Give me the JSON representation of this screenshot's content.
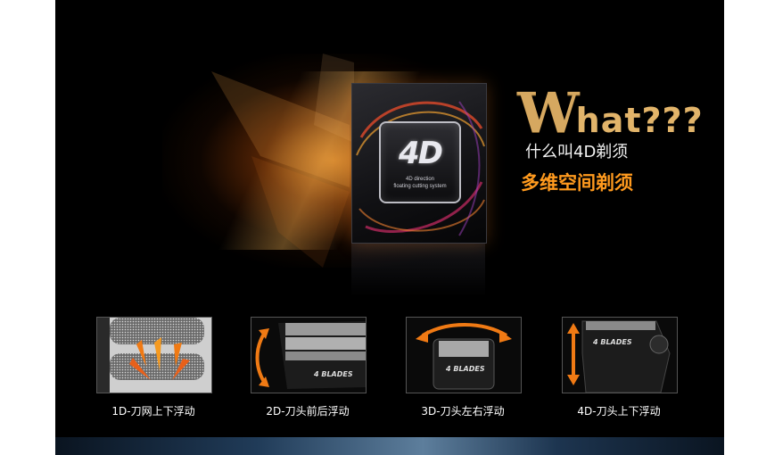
{
  "product_box": {
    "logo": "4D",
    "subtitle_line1": "4D direction",
    "subtitle_line2": "floating cutting system"
  },
  "headline": {
    "w": "W",
    "rest": "hat???",
    "line1": "什么叫4D剃须",
    "line2": "多维空间剃须"
  },
  "features": [
    {
      "label": "1D-刀网上下浮动",
      "image": "foil-mesh-up-down"
    },
    {
      "label": "2D-刀头前后浮动",
      "image": "head-front-back",
      "blade_text": "4 BLADES"
    },
    {
      "label": "3D-刀头左右浮动",
      "image": "head-left-right",
      "blade_text": "4 BLADES"
    },
    {
      "label": "4D-刀头上下浮动",
      "image": "head-up-down",
      "blade_text": "4 BLADES"
    }
  ],
  "colors": {
    "background": "#000000",
    "accent_orange": "#ff9a1e",
    "headline_gold": "#d6a860",
    "arrow_orange": "#f07a14"
  }
}
